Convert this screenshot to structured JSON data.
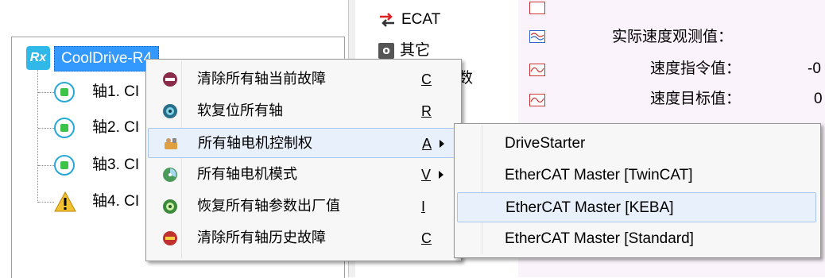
{
  "tree": {
    "root_badge": "Rx",
    "root_label": "CoolDrive-R4",
    "axes": [
      {
        "label": "轴1. CI",
        "status": "ok"
      },
      {
        "label": "轴2. CI",
        "status": "ok"
      },
      {
        "label": "轴3. CI",
        "status": "ok"
      },
      {
        "label": "轴4. CI",
        "status": "warning"
      }
    ]
  },
  "middle": {
    "items": [
      {
        "label": "ECAT",
        "icon": "ethercat-arrows-icon"
      },
      {
        "label": "其它",
        "icon": "other-icon",
        "badge": "o"
      }
    ],
    "partial_text": "数"
  },
  "right_panel": {
    "rows": [
      {
        "label": "实际速度观测值：",
        "value": ""
      },
      {
        "label": "速度指令值：",
        "value": "-0"
      },
      {
        "label": "速度目标值：",
        "value": "0"
      }
    ]
  },
  "context_menu": {
    "items": [
      {
        "label": "清除所有轴当前故障",
        "key": "C",
        "submenu": false,
        "icon": "clear-fault-icon"
      },
      {
        "label": "软复位所有轴",
        "key": "R",
        "submenu": false,
        "icon": "soft-reset-icon"
      },
      {
        "label": "所有轴电机控制权",
        "key": "A",
        "submenu": true,
        "icon": "motor-control-icon"
      },
      {
        "label": "所有轴电机模式",
        "key": "V",
        "submenu": true,
        "icon": "motor-mode-icon"
      },
      {
        "label": "恢复所有轴参数出厂值",
        "key": "I",
        "submenu": false,
        "icon": "factory-reset-icon"
      },
      {
        "label": "清除所有轴历史故障",
        "key": "C",
        "submenu": false,
        "icon": "clear-history-icon"
      }
    ],
    "hovered_index": 2
  },
  "submenu": {
    "items": [
      {
        "label": "DriveStarter"
      },
      {
        "label": "EtherCAT Master [TwinCAT]"
      },
      {
        "label": "EtherCAT Master [KEBA]"
      },
      {
        "label": "EtherCAT Master [Standard]"
      }
    ],
    "hovered_index": 2
  },
  "colors": {
    "selection": "#3399ff",
    "menu_background": "#f7f7f7",
    "hover_background": "#e7f0fb",
    "hover_border": "#a9c7ec",
    "right_panel_background": "#fbf3fb"
  }
}
